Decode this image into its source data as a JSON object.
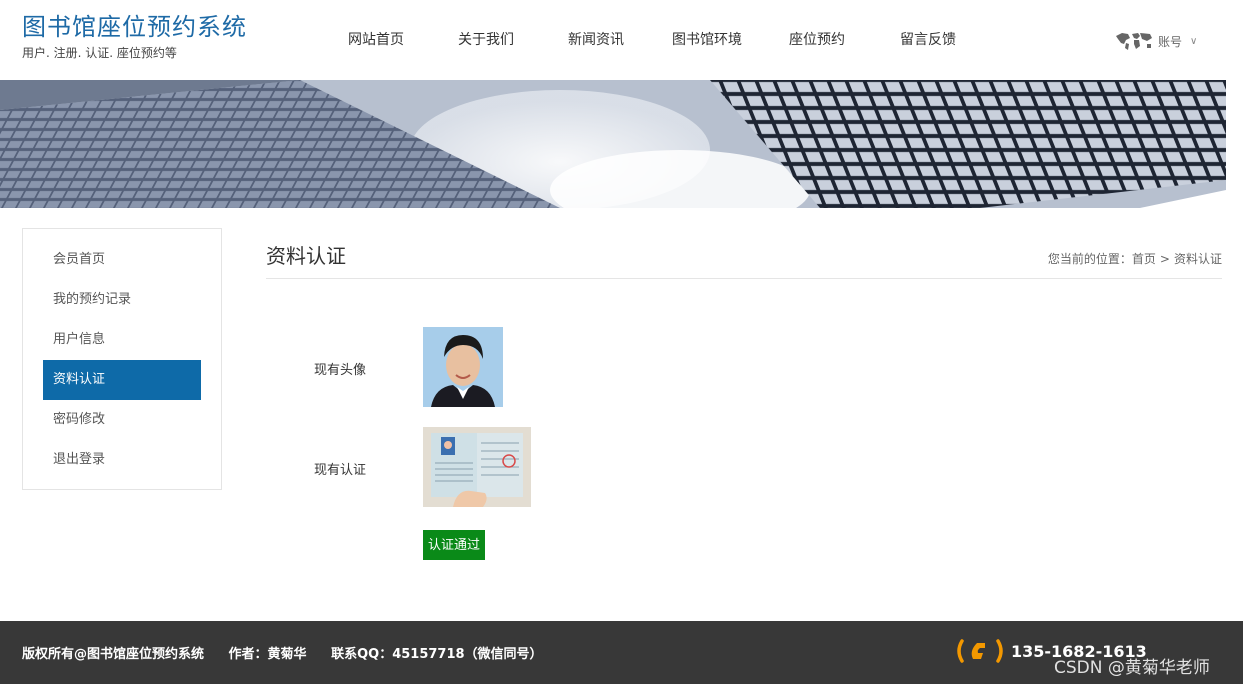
{
  "header": {
    "title": "图书馆座位预约系统",
    "subtitle": "用户. 注册. 认证. 座位预约等",
    "nav": [
      "网站首页",
      "关于我们",
      "新闻资讯",
      "图书馆环境",
      "座位预约",
      "留言反馈"
    ],
    "account_label": "账号",
    "account_chevron": "chevron-down-icon"
  },
  "sidebar": {
    "items": [
      "会员首页",
      "我的预约记录",
      "用户信息",
      "资料认证",
      "密码修改",
      "退出登录"
    ],
    "active_index": 3
  },
  "main": {
    "page_title": "资料认证",
    "breadcrumb": {
      "prefix": "您当前的位置：",
      "home": "首页",
      "separator": ">",
      "current": "资料认证"
    },
    "avatar_label": "现有头像",
    "cert_label": "现有认证",
    "verify_button": "认证通过"
  },
  "footer": {
    "copyright": "版权所有@图书馆座位预约系统",
    "author": "作者：黄菊华",
    "contact": "联系QQ：45157718（微信同号）",
    "phone": "135-1682-1613",
    "watermark": "CSDN @黄菊华老师"
  },
  "colors": {
    "brand": "#1e6aa6",
    "active": "#0e6aa8",
    "success": "#0a8a18",
    "footer_bg": "#383838",
    "phone_icon": "#f39800"
  }
}
